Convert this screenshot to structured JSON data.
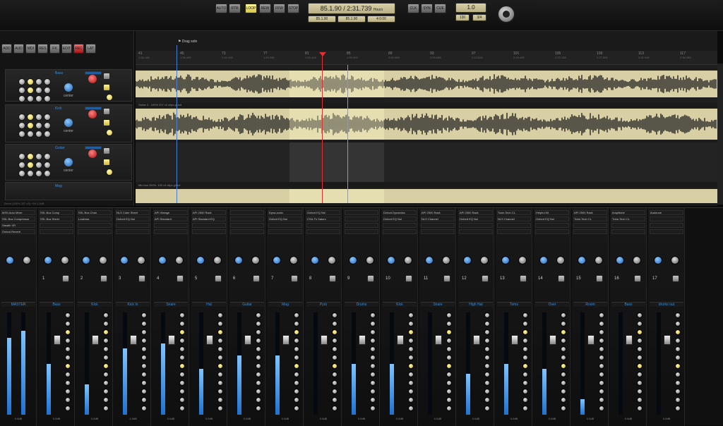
{
  "transport": {
    "position": "85.1.90 / 2:31.739",
    "unit": "Hours",
    "fields": [
      "85.1.90",
      "85.1.90",
      "4:0:00"
    ],
    "tempo": "1.0",
    "signature": [
      "130",
      "3/4"
    ],
    "buttons_left": [
      "AUTO",
      "RTR"
    ],
    "buttons_mid": [
      "LOOP",
      "REW",
      "FFW",
      "STOP",
      "REC"
    ],
    "buttons_right": [
      "CLK",
      "SYN",
      "CUE"
    ]
  },
  "toolbar": {
    "buttons": [
      "ADD",
      "AUD",
      "MDI",
      "RES",
      "FX",
      "EDIT",
      "REC",
      "LAT"
    ]
  },
  "timeline": {
    "marker": "Drag solo",
    "bars": [
      {
        "label": "41",
        "time": "1:34.188"
      },
      {
        "label": "45",
        "time": "1:38.458"
      },
      {
        "label": "73",
        "time": "1:44.108"
      },
      {
        "label": "77",
        "time": "1:49.258"
      },
      {
        "label": "81",
        "time": "1:54.418"
      },
      {
        "label": "85",
        "time": "1:59.328"
      },
      {
        "label": "89",
        "time": "2:04.308"
      },
      {
        "label": "93",
        "time": "2:09.088"
      },
      {
        "label": "97",
        "time": "2:13.828"
      },
      {
        "label": "101",
        "time": "2:18.498"
      },
      {
        "label": "105",
        "time": "2:23.108"
      },
      {
        "label": "109",
        "time": "2:27.508"
      },
      {
        "label": "113",
        "time": "2:31.948"
      },
      {
        "label": "117",
        "time": "2:36.288"
      }
    ],
    "clip_labels": [
      "Guitar 2 - 100% 207 x3 clips glued",
      "Guitar 2 - 100% 100 x3 clips glued",
      "Mix bus 100%, 100 x3 clips glued"
    ],
    "footer": "Drum (100% 207 x3) +16 1.3dB"
  },
  "tracks": [
    {
      "name": "Bass",
      "pan": "center"
    },
    {
      "name": "Kick",
      "pan": "center"
    },
    {
      "name": "Guitar",
      "pan": "center"
    },
    {
      "name": "Mag",
      "pan": "center"
    }
  ],
  "mixer": {
    "master": {
      "name": "MASTER",
      "inserts": [
        "MSS Auto Mixer",
        "SSL Bus Compressor",
        "Stealth VR",
        "Oxford Reverb"
      ],
      "gain": "0.0dB"
    },
    "channels": [
      {
        "num": "1",
        "name": "Bass",
        "inserts": [
          "SSL Bus Comp",
          "SSL Bus Sheet"
        ],
        "gain": "0.0dB",
        "level": 0.5
      },
      {
        "num": "2",
        "name": "Kick",
        "inserts": [
          "SSL Bus Chan",
          "Lowlows"
        ],
        "gain": "0.0dB",
        "level": 0.3
      },
      {
        "num": "3",
        "name": "Kick In",
        "inserts": [
          "NLS Cube Sheet",
          "Oxford EQ Noi"
        ],
        "gain": "-1.0dB",
        "level": 0.65
      },
      {
        "num": "4",
        "name": "Snare",
        "inserts": [
          "API Vintage",
          "API Standard"
        ],
        "gain": "0.0dB",
        "level": 0.7
      },
      {
        "num": "5",
        "name": "Hat",
        "inserts": [
          "API 2500 Rack",
          "API Standard EQ"
        ],
        "gain": "0.0dB",
        "level": 0.45
      },
      {
        "num": "6",
        "name": "Guitar",
        "inserts": [],
        "gain": "0.0dB",
        "level": 0.58
      },
      {
        "num": "7",
        "name": "Mag",
        "inserts": [
          "Dyna-sonic",
          "Oxford EQ Noi"
        ],
        "gain": "0.0dB",
        "level": 0.58
      },
      {
        "num": "8",
        "name": "Pyro",
        "inserts": [
          "Oxford EQ Noi",
          "CSA-Tk Saturn"
        ],
        "gain": "0.0dB",
        "level": 0.0
      },
      {
        "num": "9",
        "name": "Drums",
        "inserts": [],
        "gain": "0.0dB",
        "level": 0.5
      },
      {
        "num": "10",
        "name": "Kick",
        "inserts": [
          "Oxford Dynamics",
          "Oxford EQ Noi"
        ],
        "gain": "0.0dB",
        "level": 0.5
      },
      {
        "num": "11",
        "name": "Snare",
        "inserts": [
          "API 2500 Rack",
          "NLS Channel"
        ],
        "gain": "0.0dB",
        "level": 0.0
      },
      {
        "num": "12",
        "name": "High Hat",
        "inserts": [
          "API 2500 Rack",
          "Oxford EQ Noi"
        ],
        "gain": "0.0dB",
        "level": 0.4
      },
      {
        "num": "13",
        "name": "Toms",
        "inserts": [
          "Tube-Tech CL",
          "NLS Channel"
        ],
        "gain": "0.0dB",
        "level": 0.5
      },
      {
        "num": "14",
        "name": "Over",
        "inserts": [
          "Helpful Kit",
          "Oxford EQ Noi"
        ],
        "gain": "0.0dB",
        "level": 0.45
      },
      {
        "num": "15",
        "name": "Room",
        "inserts": [
          "API 2500 Rack",
          "Tube-Tech CL"
        ],
        "gain": "0.0dB",
        "level": 0.15
      },
      {
        "num": "16",
        "name": "Bass",
        "inserts": [
          "Amplitube",
          "Tube-Tech CL"
        ],
        "gain": "0.0dB",
        "level": 0.0
      },
      {
        "num": "17",
        "name": "drums out",
        "inserts": [
          "Autotune"
        ],
        "gain": "0.0dB",
        "level": 0.0
      }
    ]
  },
  "colors": {
    "accent": "#3b8fe0",
    "clip": "#d8cfa4",
    "playhead": "#e03030",
    "meter": "#3b8fe0"
  }
}
